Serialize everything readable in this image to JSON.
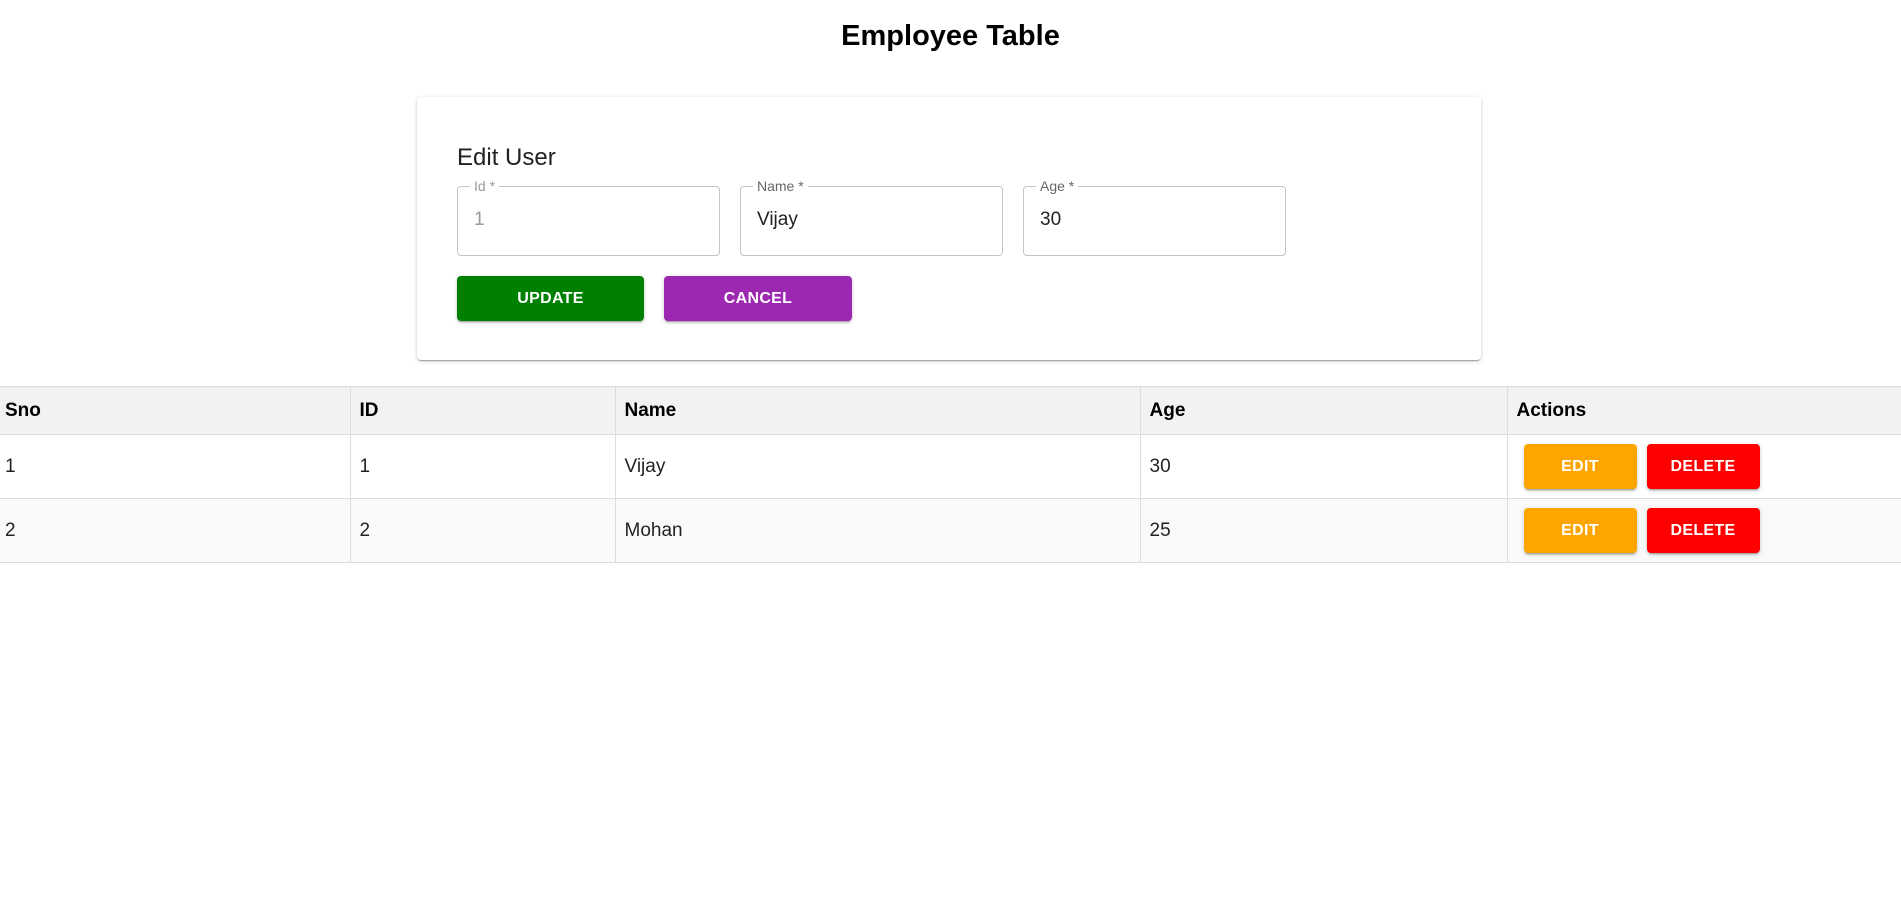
{
  "page": {
    "title": "Employee Table"
  },
  "edit_form": {
    "title": "Edit User",
    "fields": [
      {
        "label": "Id *",
        "value": "1",
        "disabled": true
      },
      {
        "label": "Name *",
        "value": "Vijay",
        "disabled": false
      },
      {
        "label": "Age *",
        "value": "30",
        "disabled": false
      }
    ],
    "update_label": "UPDATE",
    "cancel_label": "CANCEL"
  },
  "table": {
    "headers": [
      "Sno",
      "ID",
      "Name",
      "Age",
      "Actions"
    ],
    "rows": [
      {
        "sno": "1",
        "id": "1",
        "name": "Vijay",
        "age": "30"
      },
      {
        "sno": "2",
        "id": "2",
        "name": "Mohan",
        "age": "25"
      }
    ],
    "edit_label": "EDIT",
    "delete_label": "DELETE"
  },
  "colors": {
    "update": "#008000",
    "cancel": "#9c27b0",
    "edit": "#ffa500",
    "delete": "#ff0000"
  }
}
